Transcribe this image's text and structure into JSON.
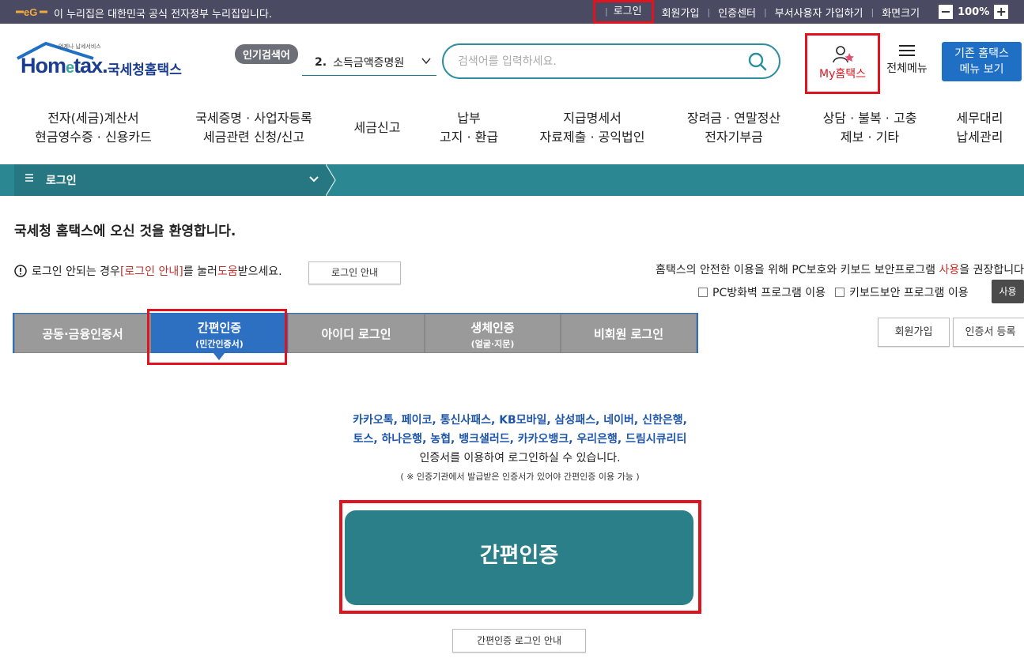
{
  "gov_bar": {
    "logo_icon": "eg-emblem-icon",
    "notice": "이 누리집은 대한민국 공식 전자정부 누리집입니다.",
    "links": {
      "login": "로그인",
      "signup": "회원가입",
      "cert_center": "인증센터",
      "dept_signup": "부서사용자 가입하기",
      "screen_size": "화면크기"
    },
    "zoom_minus": "−",
    "zoom_value": "100%",
    "zoom_plus": "+"
  },
  "header": {
    "logo_sub": "언제나 납세서비스",
    "logo_home": "Hom",
    "logo_e": "e",
    "logo_tax": "tax.",
    "logo_name": "국세청홈택스",
    "popular_badge": "인기검색어",
    "popular_number": "2.",
    "popular_term": "소득금액증명원",
    "search_placeholder": "검색어를 입력하세요.",
    "my_hometax": "My홈택스",
    "all_menu": "전체메뉴",
    "old_menu_line1": "기존 홈택스",
    "old_menu_line2": "메뉴 보기"
  },
  "gnb": [
    {
      "l1": "전자(세금)계산서",
      "l2": "현금영수증 · 신용카드"
    },
    {
      "l1": "국세증명 · 사업자등록",
      "l2": "세금관련 신청/신고"
    },
    {
      "l1": "세금신고",
      "l2": ""
    },
    {
      "l1": "납부",
      "l2": "고지 · 환급"
    },
    {
      "l1": "지급명세서",
      "l2": "자료제출 · 공익법인"
    },
    {
      "l1": "장려금 · 연말정산",
      "l2": "전자기부금"
    },
    {
      "l1": "상담 · 불복 · 고충",
      "l2": "제보 · 기타"
    },
    {
      "l1": "세무대리",
      "l2": "납세관리"
    }
  ],
  "breadcrumb": {
    "label": "로그인"
  },
  "welcome": "국세청 홈택스에 오신 것을 환영합니다.",
  "login_help": {
    "pre": "로그인 안되는 경우 ",
    "link": "[로그인 안내]",
    "mid": "를 눌러 ",
    "red2": "도움",
    "post": "받으세요.",
    "button": "로그인 안내"
  },
  "security": {
    "msg_pre": "홈택스의 안전한 이용을 위해 PC보호와 키보드 보안프로그램 ",
    "msg_red": "사용",
    "msg_post": "을 권장합니다",
    "pc_firewall": "PC방화벽 프로그램 이용",
    "keyboard": "키보드보안 프로그램 이용",
    "use_button": "사용"
  },
  "tabs": [
    {
      "label": "공동·금융인증서",
      "sub": ""
    },
    {
      "label": "간편인증",
      "sub": "(민간인증서)"
    },
    {
      "label": "아이디 로그인",
      "sub": ""
    },
    {
      "label": "생체인증",
      "sub": "(얼굴·지문)"
    },
    {
      "label": "비회원 로그인",
      "sub": ""
    }
  ],
  "side_buttons": {
    "join": "회원가입",
    "cert_register": "인증서 등록"
  },
  "content": {
    "providers_line1": "카카오톡, 페이코, 통신사패스, KB모바일, 삼성패스, 네이버, 신한은행,",
    "providers_line2": "토스, 하나은행, 농협, 뱅크샐러드, 카카오뱅크, 우리은행, 드림시큐리티",
    "providers_line3": "인증서를 이용하여 로그인하실 수 있습니다.",
    "note": "( ※ 인증기관에서 발급받은 인증서가 있어야 간편인증 이용 가능 )",
    "main_button": "간편인증",
    "guide_button": "간편인증 로그인 안내"
  },
  "colors": {
    "gov_bar": "#4a4a63",
    "teal": "#2b8792",
    "tab_active": "#2d6fc1",
    "highlight": "#e0141e"
  }
}
